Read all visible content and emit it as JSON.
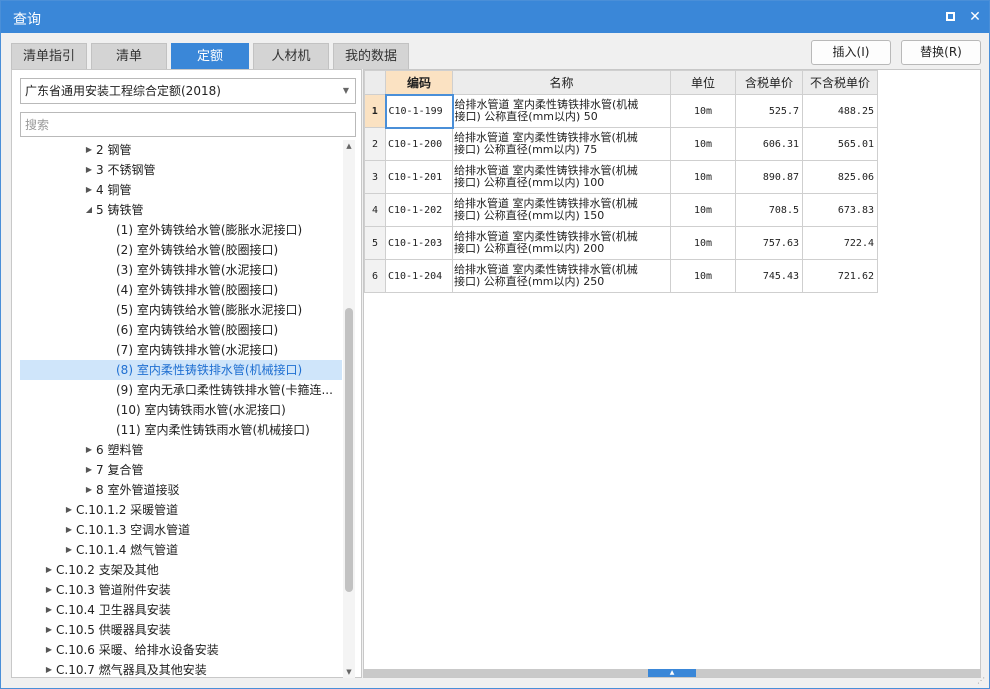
{
  "window": {
    "title": "查询",
    "maximize_icon": "maximize-icon",
    "close_icon": "close-icon",
    "close_glyph": "✕"
  },
  "tabs": [
    {
      "label": "清单指引",
      "active": false
    },
    {
      "label": "清单",
      "active": false
    },
    {
      "label": "定额",
      "active": true
    },
    {
      "label": "人材机",
      "active": false
    },
    {
      "label": "我的数据",
      "active": false
    }
  ],
  "actions": {
    "insert_label": "插入(I)",
    "replace_label": "替换(R)"
  },
  "library_select": {
    "value": "广东省通用安装工程综合定额(2018)"
  },
  "search": {
    "placeholder": "搜索",
    "value": ""
  },
  "tree": [
    {
      "label": "2 钢管",
      "expanded": false,
      "has_children": true
    },
    {
      "label": "3 不锈钢管",
      "expanded": false,
      "has_children": true
    },
    {
      "label": "4 铜管",
      "expanded": false,
      "has_children": true
    },
    {
      "label": "5 铸铁管",
      "expanded": true,
      "has_children": true
    },
    {
      "label": "(1) 室外铸铁给水管(膨胀水泥接口)",
      "has_children": false
    },
    {
      "label": "(2) 室外铸铁给水管(胶圈接口)",
      "has_children": false
    },
    {
      "label": "(3) 室外铸铁排水管(水泥接口)",
      "has_children": false
    },
    {
      "label": "(4) 室外铸铁排水管(胶圈接口)",
      "has_children": false
    },
    {
      "label": "(5) 室内铸铁给水管(膨胀水泥接口)",
      "has_children": false
    },
    {
      "label": "(6) 室内铸铁给水管(胶圈接口)",
      "has_children": false
    },
    {
      "label": "(7) 室内铸铁排水管(水泥接口)",
      "has_children": false
    },
    {
      "label": "(8) 室内柔性铸铁排水管(机械接口)",
      "has_children": false,
      "selected": true
    },
    {
      "label": "(9) 室内无承口柔性铸铁排水管(卡箍连...",
      "has_children": false
    },
    {
      "label": "(10) 室内铸铁雨水管(水泥接口)",
      "has_children": false
    },
    {
      "label": "(11) 室内柔性铸铁雨水管(机械接口)",
      "has_children": false
    },
    {
      "label": "6 塑料管",
      "expanded": false,
      "has_children": true
    },
    {
      "label": "7 复合管",
      "expanded": false,
      "has_children": true
    },
    {
      "label": "8 室外管道接驳",
      "expanded": false,
      "has_children": true
    },
    {
      "label": "C.10.1.2 采暖管道",
      "expanded": false,
      "has_children": true
    },
    {
      "label": "C.10.1.3 空调水管道",
      "expanded": false,
      "has_children": true
    },
    {
      "label": "C.10.1.4 燃气管道",
      "expanded": false,
      "has_children": true
    },
    {
      "label": "C.10.2 支架及其他",
      "expanded": false,
      "has_children": true
    },
    {
      "label": "C.10.3 管道附件安装",
      "expanded": false,
      "has_children": true
    },
    {
      "label": "C.10.4 卫生器具安装",
      "expanded": false,
      "has_children": true
    },
    {
      "label": "C.10.5 供暖器具安装",
      "expanded": false,
      "has_children": true
    },
    {
      "label": "C.10.6 采暖、给排水设备安装",
      "expanded": false,
      "has_children": true
    },
    {
      "label": "C.10.7 燃气器具及其他安装",
      "expanded": false,
      "has_children": true
    }
  ],
  "table": {
    "headers": {
      "code": "编码",
      "name": "名称",
      "unit": "单位",
      "price_tax": "含税单价",
      "price_notax": "不含税单价"
    },
    "rows": [
      {
        "no": "1",
        "code": "C10-1-199",
        "name_line1": "给排水管道 室内柔性铸铁排水管(机械",
        "name_line2": "接口) 公称直径(mm以内) 50",
        "unit": "10m",
        "price_tax": "525.7",
        "price_notax": "488.25"
      },
      {
        "no": "2",
        "code": "C10-1-200",
        "name_line1": "给排水管道 室内柔性铸铁排水管(机械",
        "name_line2": "接口) 公称直径(mm以内) 75",
        "unit": "10m",
        "price_tax": "606.31",
        "price_notax": "565.01"
      },
      {
        "no": "3",
        "code": "C10-1-201",
        "name_line1": "给排水管道 室内柔性铸铁排水管(机械",
        "name_line2": "接口) 公称直径(mm以内) 100",
        "unit": "10m",
        "price_tax": "890.87",
        "price_notax": "825.06"
      },
      {
        "no": "4",
        "code": "C10-1-202",
        "name_line1": "给排水管道 室内柔性铸铁排水管(机械",
        "name_line2": "接口) 公称直径(mm以内) 150",
        "unit": "10m",
        "price_tax": "708.5",
        "price_notax": "673.83"
      },
      {
        "no": "5",
        "code": "C10-1-203",
        "name_line1": "给排水管道 室内柔性铸铁排水管(机械",
        "name_line2": "接口) 公称直径(mm以内) 200",
        "unit": "10m",
        "price_tax": "757.63",
        "price_notax": "722.4"
      },
      {
        "no": "6",
        "code": "C10-1-204",
        "name_line1": "给排水管道 室内柔性铸铁排水管(机械",
        "name_line2": "接口) 公称直径(mm以内) 250",
        "unit": "10m",
        "price_tax": "745.43",
        "price_notax": "721.62"
      }
    ]
  },
  "colors": {
    "accent": "#3a87d8",
    "selected_row_bg": "#cfe5fa",
    "header_highlight": "#fbe2c2"
  }
}
